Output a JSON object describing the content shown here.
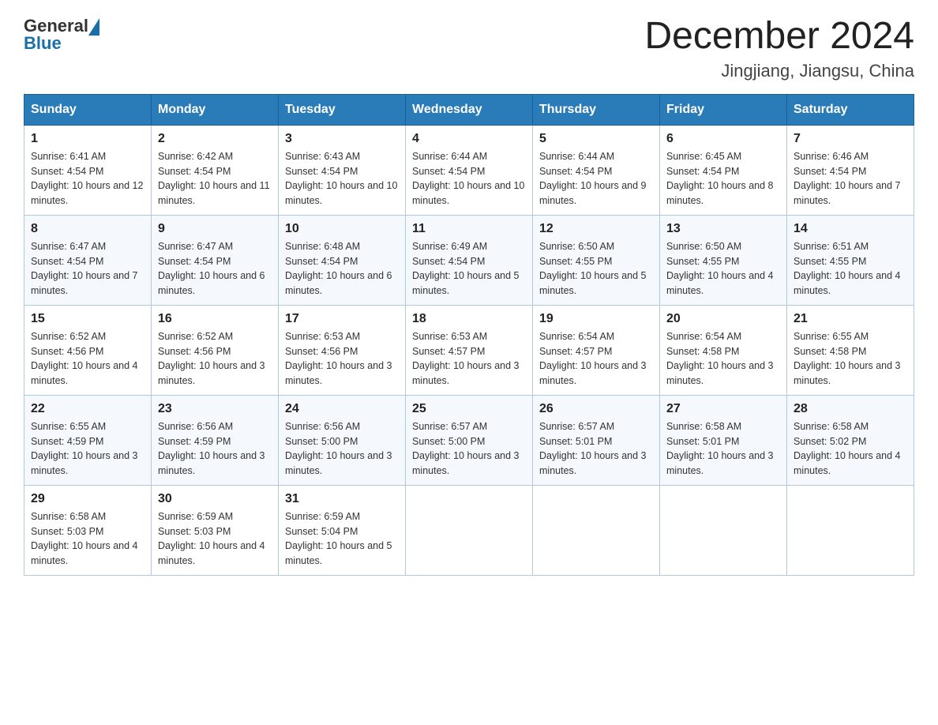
{
  "logo": {
    "text_general": "General",
    "text_blue": "Blue"
  },
  "title": "December 2024",
  "subtitle": "Jingjiang, Jiangsu, China",
  "days_of_week": [
    "Sunday",
    "Monday",
    "Tuesday",
    "Wednesday",
    "Thursday",
    "Friday",
    "Saturday"
  ],
  "weeks": [
    [
      {
        "day": "1",
        "sunrise": "6:41 AM",
        "sunset": "4:54 PM",
        "daylight": "10 hours and 12 minutes."
      },
      {
        "day": "2",
        "sunrise": "6:42 AM",
        "sunset": "4:54 PM",
        "daylight": "10 hours and 11 minutes."
      },
      {
        "day": "3",
        "sunrise": "6:43 AM",
        "sunset": "4:54 PM",
        "daylight": "10 hours and 10 minutes."
      },
      {
        "day": "4",
        "sunrise": "6:44 AM",
        "sunset": "4:54 PM",
        "daylight": "10 hours and 10 minutes."
      },
      {
        "day": "5",
        "sunrise": "6:44 AM",
        "sunset": "4:54 PM",
        "daylight": "10 hours and 9 minutes."
      },
      {
        "day": "6",
        "sunrise": "6:45 AM",
        "sunset": "4:54 PM",
        "daylight": "10 hours and 8 minutes."
      },
      {
        "day": "7",
        "sunrise": "6:46 AM",
        "sunset": "4:54 PM",
        "daylight": "10 hours and 7 minutes."
      }
    ],
    [
      {
        "day": "8",
        "sunrise": "6:47 AM",
        "sunset": "4:54 PM",
        "daylight": "10 hours and 7 minutes."
      },
      {
        "day": "9",
        "sunrise": "6:47 AM",
        "sunset": "4:54 PM",
        "daylight": "10 hours and 6 minutes."
      },
      {
        "day": "10",
        "sunrise": "6:48 AM",
        "sunset": "4:54 PM",
        "daylight": "10 hours and 6 minutes."
      },
      {
        "day": "11",
        "sunrise": "6:49 AM",
        "sunset": "4:54 PM",
        "daylight": "10 hours and 5 minutes."
      },
      {
        "day": "12",
        "sunrise": "6:50 AM",
        "sunset": "4:55 PM",
        "daylight": "10 hours and 5 minutes."
      },
      {
        "day": "13",
        "sunrise": "6:50 AM",
        "sunset": "4:55 PM",
        "daylight": "10 hours and 4 minutes."
      },
      {
        "day": "14",
        "sunrise": "6:51 AM",
        "sunset": "4:55 PM",
        "daylight": "10 hours and 4 minutes."
      }
    ],
    [
      {
        "day": "15",
        "sunrise": "6:52 AM",
        "sunset": "4:56 PM",
        "daylight": "10 hours and 4 minutes."
      },
      {
        "day": "16",
        "sunrise": "6:52 AM",
        "sunset": "4:56 PM",
        "daylight": "10 hours and 3 minutes."
      },
      {
        "day": "17",
        "sunrise": "6:53 AM",
        "sunset": "4:56 PM",
        "daylight": "10 hours and 3 minutes."
      },
      {
        "day": "18",
        "sunrise": "6:53 AM",
        "sunset": "4:57 PM",
        "daylight": "10 hours and 3 minutes."
      },
      {
        "day": "19",
        "sunrise": "6:54 AM",
        "sunset": "4:57 PM",
        "daylight": "10 hours and 3 minutes."
      },
      {
        "day": "20",
        "sunrise": "6:54 AM",
        "sunset": "4:58 PM",
        "daylight": "10 hours and 3 minutes."
      },
      {
        "day": "21",
        "sunrise": "6:55 AM",
        "sunset": "4:58 PM",
        "daylight": "10 hours and 3 minutes."
      }
    ],
    [
      {
        "day": "22",
        "sunrise": "6:55 AM",
        "sunset": "4:59 PM",
        "daylight": "10 hours and 3 minutes."
      },
      {
        "day": "23",
        "sunrise": "6:56 AM",
        "sunset": "4:59 PM",
        "daylight": "10 hours and 3 minutes."
      },
      {
        "day": "24",
        "sunrise": "6:56 AM",
        "sunset": "5:00 PM",
        "daylight": "10 hours and 3 minutes."
      },
      {
        "day": "25",
        "sunrise": "6:57 AM",
        "sunset": "5:00 PM",
        "daylight": "10 hours and 3 minutes."
      },
      {
        "day": "26",
        "sunrise": "6:57 AM",
        "sunset": "5:01 PM",
        "daylight": "10 hours and 3 minutes."
      },
      {
        "day": "27",
        "sunrise": "6:58 AM",
        "sunset": "5:01 PM",
        "daylight": "10 hours and 3 minutes."
      },
      {
        "day": "28",
        "sunrise": "6:58 AM",
        "sunset": "5:02 PM",
        "daylight": "10 hours and 4 minutes."
      }
    ],
    [
      {
        "day": "29",
        "sunrise": "6:58 AM",
        "sunset": "5:03 PM",
        "daylight": "10 hours and 4 minutes."
      },
      {
        "day": "30",
        "sunrise": "6:59 AM",
        "sunset": "5:03 PM",
        "daylight": "10 hours and 4 minutes."
      },
      {
        "day": "31",
        "sunrise": "6:59 AM",
        "sunset": "5:04 PM",
        "daylight": "10 hours and 5 minutes."
      },
      null,
      null,
      null,
      null
    ]
  ]
}
